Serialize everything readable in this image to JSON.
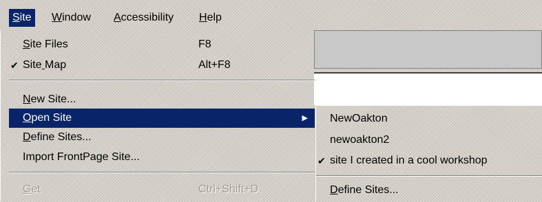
{
  "menubar": {
    "items": [
      {
        "label": "Site",
        "mnemonic": "S",
        "rest": "ite",
        "active": true
      },
      {
        "label": "Window",
        "mnemonic": "W",
        "rest": "indow"
      },
      {
        "label": "Accessibility",
        "mnemonic": "A",
        "rest": "ccessibility"
      },
      {
        "label": "Help",
        "mnemonic": "H",
        "rest": "elp"
      }
    ]
  },
  "site_menu": {
    "site_files": {
      "pre": "",
      "mnemonic": "S",
      "post": "ite Files",
      "shortcut": "F8"
    },
    "site_map": {
      "pre": "Site",
      "mnemonic": " ",
      "post": "Map",
      "shortcut": "Alt+F8",
      "checked": true,
      "check_glyph": "✔"
    },
    "new_site": {
      "pre": "",
      "mnemonic": "N",
      "post": "ew Site..."
    },
    "open_site": {
      "pre": "",
      "mnemonic": "O",
      "post": "pen Site",
      "submenu_arrow": "▶",
      "selected": true
    },
    "define_sites": {
      "pre": "",
      "mnemonic": "D",
      "post": "efine Sites..."
    },
    "import_frontpage": {
      "label": "Import FrontPage Site..."
    },
    "get": {
      "pre": "",
      "mnemonic": "G",
      "post": "et",
      "shortcut": "Ctrl+Shift+D",
      "disabled": true
    }
  },
  "open_site_submenu": {
    "items": [
      {
        "label": "NewOakton"
      },
      {
        "label": "newoakton2"
      },
      {
        "label": "site I created in a cool workshop",
        "checked": true,
        "check_glyph": "✔"
      }
    ],
    "define_sites": {
      "pre": "",
      "mnemonic": "D",
      "post": "efine Sites..."
    }
  }
}
